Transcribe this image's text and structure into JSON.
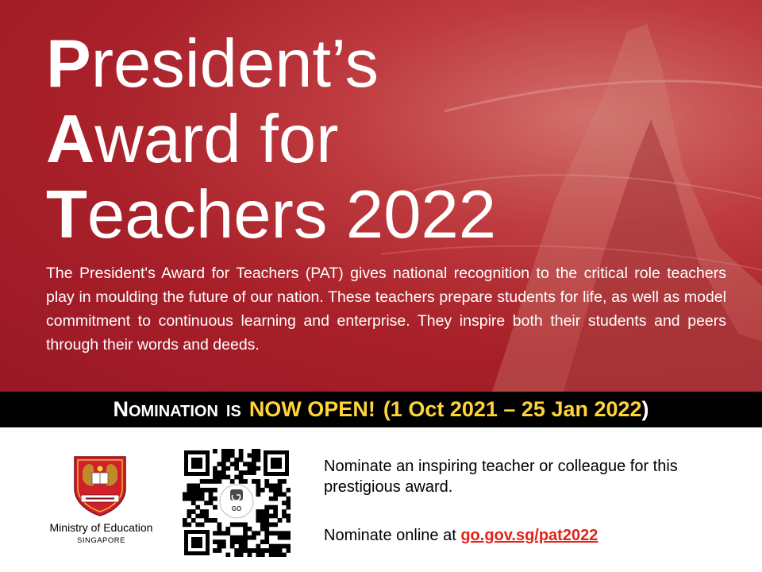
{
  "title": {
    "line1": {
      "cap": "P",
      "rest": "resident’s"
    },
    "line2": {
      "cap": "A",
      "rest": "ward for"
    },
    "line3": {
      "cap": "T",
      "rest": "eachers 2022"
    }
  },
  "intro": "The President's Award for Teachers (PAT) gives national recognition to the critical role teachers play in moulding the future of our nation. These teachers prepare students for life, as well as model commitment to continuous learning and enterprise. They inspire both their students and peers through their words and deeds.",
  "nomination": {
    "n_cap": "N",
    "n_rest": "OMINATION",
    "is_cap": "IS",
    "open": "NOW OPEN!",
    "dates": "(1 Oct 2021 – 25 Jan 2022",
    "close": ")"
  },
  "moe": {
    "name": "Ministry of Education",
    "sub": "SINGAPORE"
  },
  "qr": {
    "icon": "qr-code-icon",
    "badge_logo": "gov-logo-icon"
  },
  "cta": {
    "line1": "Nominate an inspiring teacher or colleague for this prestigious award.",
    "online_prefix": "Nominate online at ",
    "link": "go.gov.sg/pat2022"
  },
  "colors": {
    "hero_red": "#a82029",
    "highlight_yellow": "#ffd43b",
    "link_red": "#e2231a",
    "bar_black": "#000000"
  }
}
